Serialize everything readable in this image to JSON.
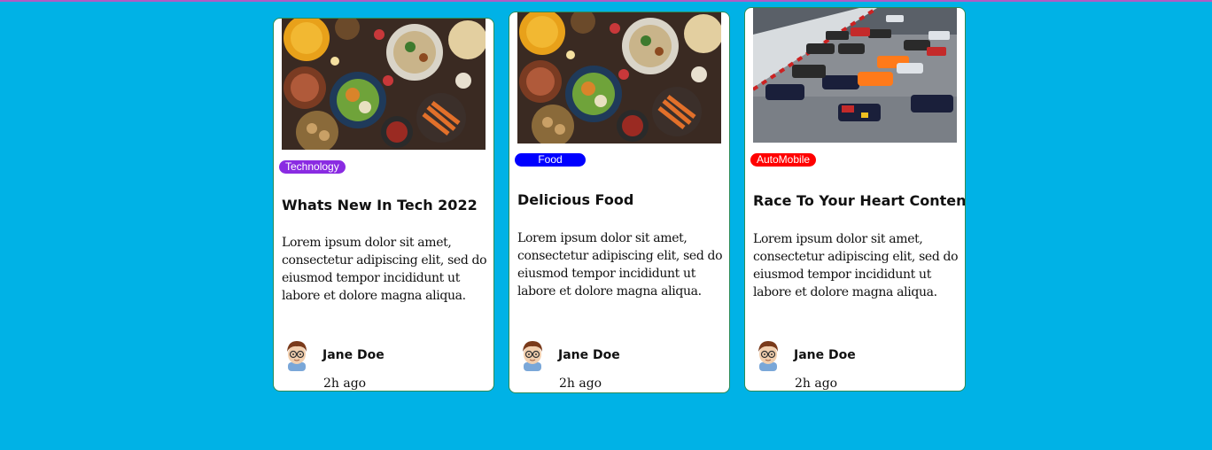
{
  "cards": [
    {
      "category": "Technology",
      "category_color": "#8a2be2",
      "title": "Whats New In Tech 2022",
      "description": "Lorem ipsum dolor sit amet, consectetur adipiscing elit, sed do eiusmod tempor incididunt ut labore et dolore magna aliqua.",
      "author": "Jane Doe",
      "time": "2h ago",
      "image": "food-image"
    },
    {
      "category": "Food",
      "category_color": "#0000ff",
      "title": "Delicious Food",
      "description": "Lorem ipsum dolor sit amet, consectetur adipiscing elit, sed do eiusmod tempor incididunt ut labore et dolore magna aliqua.",
      "author": "Jane Doe",
      "time": "2h ago",
      "image": "food-image"
    },
    {
      "category": "AutoMobile",
      "category_color": "#ff0000",
      "title": "Race To Your Heart Content",
      "description": "Lorem ipsum dolor sit amet, consectetur adipiscing elit, sed do eiusmod tempor incididunt ut labore et dolore magna aliqua.",
      "author": "Jane Doe",
      "time": "2h ago",
      "image": "race-cars-image"
    }
  ]
}
